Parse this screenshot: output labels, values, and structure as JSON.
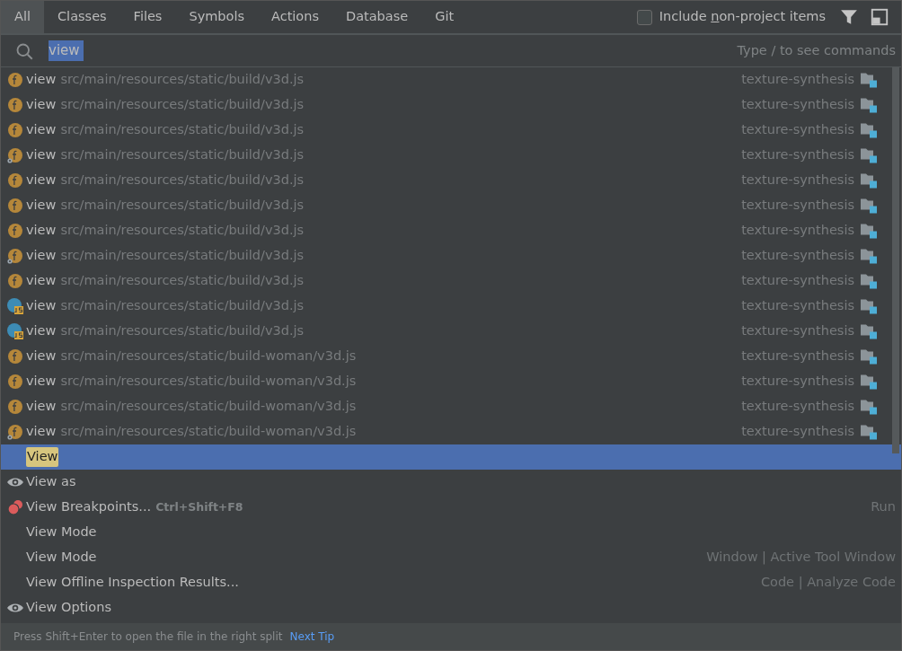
{
  "tabs": [
    {
      "label": "All",
      "selected": true
    },
    {
      "label": "Classes",
      "selected": false
    },
    {
      "label": "Files",
      "selected": false
    },
    {
      "label": "Symbols",
      "selected": false
    },
    {
      "label": "Actions",
      "selected": false
    },
    {
      "label": "Database",
      "selected": false
    },
    {
      "label": "Git",
      "selected": false
    }
  ],
  "include_non_project": {
    "label_parts": [
      "Include ",
      "n",
      "on-project items"
    ],
    "checked": false
  },
  "search": {
    "value": "view",
    "hint": "Type / to see commands"
  },
  "results": [
    {
      "kind": "function",
      "name": "view",
      "path": "src/main/resources/static/build/v3d.js",
      "project": "texture-synthesis"
    },
    {
      "kind": "function",
      "name": "view",
      "path": "src/main/resources/static/build/v3d.js",
      "project": "texture-synthesis"
    },
    {
      "kind": "function",
      "name": "view",
      "path": "src/main/resources/static/build/v3d.js",
      "project": "texture-synthesis"
    },
    {
      "kind": "gearfunction",
      "name": "view",
      "path": "src/main/resources/static/build/v3d.js",
      "project": "texture-synthesis"
    },
    {
      "kind": "function",
      "name": "view",
      "path": "src/main/resources/static/build/v3d.js",
      "project": "texture-synthesis"
    },
    {
      "kind": "function",
      "name": "view",
      "path": "src/main/resources/static/build/v3d.js",
      "project": "texture-synthesis"
    },
    {
      "kind": "function",
      "name": "view",
      "path": "src/main/resources/static/build/v3d.js",
      "project": "texture-synthesis"
    },
    {
      "kind": "gearfunction",
      "name": "view",
      "path": "src/main/resources/static/build/v3d.js",
      "project": "texture-synthesis"
    },
    {
      "kind": "function",
      "name": "view",
      "path": "src/main/resources/static/build/v3d.js",
      "project": "texture-synthesis"
    },
    {
      "kind": "javascript",
      "name": "view",
      "path": "src/main/resources/static/build/v3d.js",
      "project": "texture-synthesis"
    },
    {
      "kind": "javascript",
      "name": "view",
      "path": "src/main/resources/static/build/v3d.js",
      "project": "texture-synthesis"
    },
    {
      "kind": "function",
      "name": "view",
      "path": "src/main/resources/static/build-woman/v3d.js",
      "project": "texture-synthesis"
    },
    {
      "kind": "function",
      "name": "view",
      "path": "src/main/resources/static/build-woman/v3d.js",
      "project": "texture-synthesis"
    },
    {
      "kind": "function",
      "name": "view",
      "path": "src/main/resources/static/build-woman/v3d.js",
      "project": "texture-synthesis"
    },
    {
      "kind": "gearfunction",
      "name": "view",
      "path": "src/main/resources/static/build-woman/v3d.js",
      "project": "texture-synthesis"
    },
    {
      "kind": "action",
      "name": "View",
      "selected": true
    },
    {
      "kind": "eye",
      "name": "View as",
      "selected": false
    },
    {
      "kind": "breakpoints",
      "name": "View Breakpoints...",
      "shortcut": "Ctrl+Shift+F8",
      "group": "Run",
      "selected": false
    },
    {
      "kind": "action",
      "name": "View Mode",
      "selected": false
    },
    {
      "kind": "action",
      "name": "View Mode",
      "group": "Window | Active Tool Window",
      "selected": false
    },
    {
      "kind": "action",
      "name": "View Offline Inspection Results...",
      "group": "Code | Analyze Code",
      "selected": false
    },
    {
      "kind": "eye",
      "name": "View Options",
      "selected": false
    }
  ],
  "footer": {
    "tip": "Press Shift+Enter to open the file in the right split",
    "link": "Next Tip"
  }
}
